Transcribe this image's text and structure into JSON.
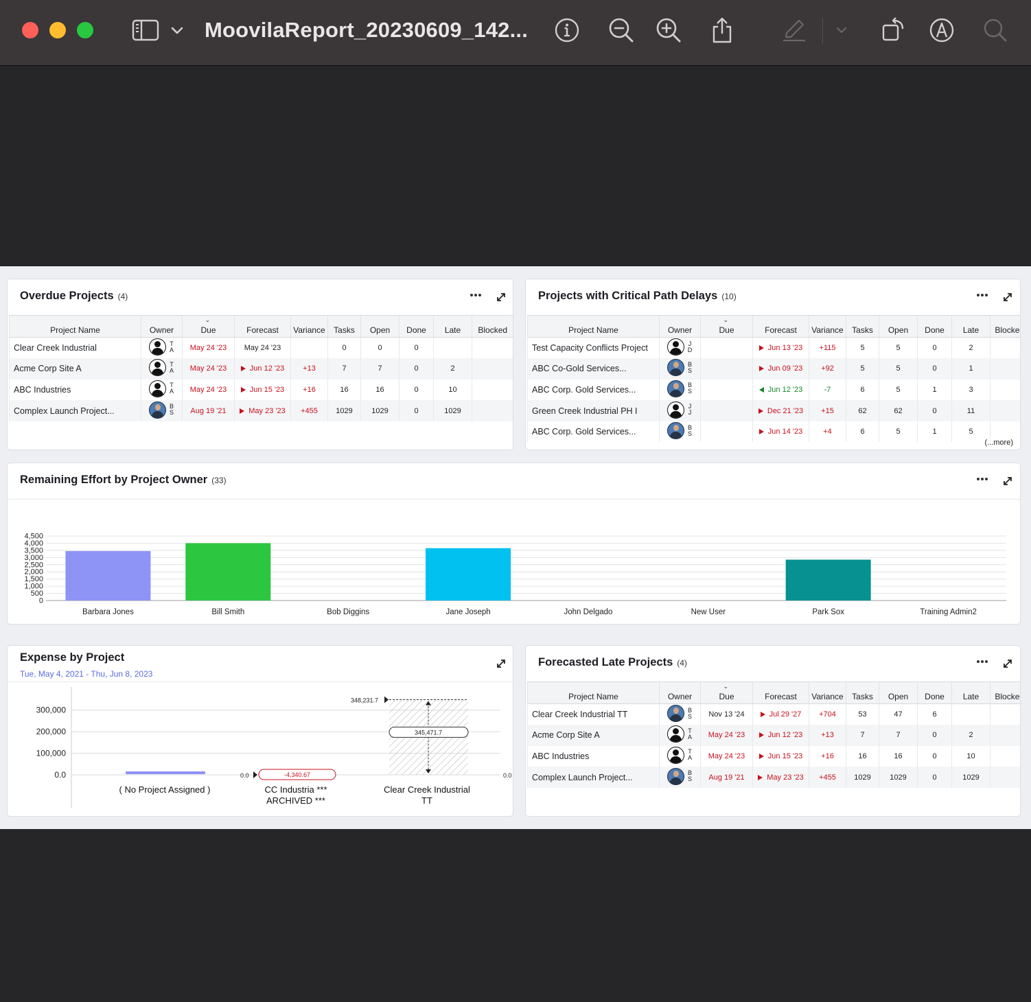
{
  "window": {
    "title": "MoovilaReport_20230609_142..."
  },
  "overdue": {
    "title": "Overdue Projects",
    "count": "(4)",
    "columns": [
      "Project Name",
      "Owner",
      "Due",
      "Forecast",
      "Variance",
      "Tasks",
      "Open",
      "Done",
      "Late",
      "Blocked"
    ],
    "rows": [
      {
        "name": "Clear Creek Industrial",
        "initials": [
          "T",
          "A"
        ],
        "photo": false,
        "due": "May 24 '23",
        "due_red": true,
        "forecast": "May 24 '23",
        "forecast_flag": "none",
        "variance": "",
        "tasks": "0",
        "open": "0",
        "done": "0",
        "late": "",
        "blocked": ""
      },
      {
        "name": "Acme Corp Site A",
        "initials": [
          "T",
          "A"
        ],
        "photo": false,
        "due": "May 24 '23",
        "due_red": true,
        "forecast": "Jun 12 '23",
        "forecast_flag": "late",
        "variance": "+13",
        "tasks": "7",
        "open": "7",
        "done": "0",
        "late": "2",
        "blocked": ""
      },
      {
        "name": "ABC Industries",
        "initials": [
          "T",
          "A"
        ],
        "photo": false,
        "due": "May 24 '23",
        "due_red": true,
        "forecast": "Jun 15 '23",
        "forecast_flag": "late",
        "variance": "+16",
        "tasks": "16",
        "open": "16",
        "done": "0",
        "late": "10",
        "blocked": ""
      },
      {
        "name": "Complex Launch Project...",
        "initials": [
          "B",
          "S"
        ],
        "photo": true,
        "due": "Aug 19 '21",
        "due_red": true,
        "forecast": "May 23 '23",
        "forecast_flag": "late",
        "variance": "+455",
        "tasks": "1029",
        "open": "1029",
        "done": "0",
        "late": "1029",
        "blocked": ""
      }
    ]
  },
  "critical": {
    "title": "Projects with Critical Path Delays",
    "count": "(10)",
    "more": "(...more)",
    "columns": [
      "Project Name",
      "Owner",
      "Due",
      "Forecast",
      "Variance",
      "Tasks",
      "Open",
      "Done",
      "Late",
      "Blocked"
    ],
    "rows": [
      {
        "name": "Test Capacity Conflicts Project",
        "initials": [
          "J",
          "D"
        ],
        "photo": false,
        "due": "",
        "due_red": false,
        "forecast": "Jun 13 '23",
        "forecast_flag": "late",
        "variance": "+115",
        "tasks": "5",
        "open": "5",
        "done": "0",
        "late": "2",
        "blocked": ""
      },
      {
        "name": "ABC Co-Gold Services...",
        "initials": [
          "B",
          "S"
        ],
        "photo": true,
        "due": "",
        "due_red": false,
        "forecast": "Jun 09 '23",
        "forecast_flag": "late",
        "variance": "+92",
        "tasks": "5",
        "open": "5",
        "done": "0",
        "late": "1",
        "blocked": ""
      },
      {
        "name": "ABC Corp. Gold Services...",
        "initials": [
          "B",
          "S"
        ],
        "photo": true,
        "due": "",
        "due_red": false,
        "forecast": "Jun 12 '23",
        "forecast_flag": "early",
        "variance": "-7",
        "tasks": "6",
        "open": "5",
        "done": "1",
        "late": "3",
        "blocked": ""
      },
      {
        "name": "Green Creek Industrial PH I",
        "initials": [
          "J",
          "J"
        ],
        "photo": false,
        "due": "",
        "due_red": false,
        "forecast": "Dec 21 '23",
        "forecast_flag": "late",
        "variance": "+15",
        "tasks": "62",
        "open": "62",
        "done": "0",
        "late": "11",
        "blocked": ""
      },
      {
        "name": "ABC Corp. Gold Services...",
        "initials": [
          "B",
          "S"
        ],
        "photo": true,
        "due": "",
        "due_red": false,
        "forecast": "Jun 14 '23",
        "forecast_flag": "late",
        "variance": "+4",
        "tasks": "6",
        "open": "5",
        "done": "1",
        "late": "5",
        "blocked": ""
      }
    ]
  },
  "effort": {
    "title": "Remaining Effort by Project Owner",
    "count": "(33)"
  },
  "expense": {
    "title": "Expense by Project",
    "subtitle": "Tue, May 4, 2021  -  Thu, Jun 8, 2023"
  },
  "forecasted": {
    "title": "Forecasted Late Projects",
    "count": "(4)",
    "columns": [
      "Project Name",
      "Owner",
      "Due",
      "Forecast",
      "Variance",
      "Tasks",
      "Open",
      "Done",
      "Late",
      "Blocked"
    ],
    "rows": [
      {
        "name": "Clear Creek Industrial TT",
        "initials": [
          "B",
          "S"
        ],
        "photo": true,
        "due": "Nov 13 '24",
        "due_red": false,
        "forecast": "Jul 29 '27",
        "forecast_flag": "late",
        "variance": "+704",
        "tasks": "53",
        "open": "47",
        "done": "6",
        "late": "",
        "blocked": ""
      },
      {
        "name": "Acme Corp Site A",
        "initials": [
          "T",
          "A"
        ],
        "photo": false,
        "due": "May 24 '23",
        "due_red": true,
        "forecast": "Jun 12 '23",
        "forecast_flag": "late",
        "variance": "+13",
        "tasks": "7",
        "open": "7",
        "done": "0",
        "late": "2",
        "blocked": ""
      },
      {
        "name": "ABC Industries",
        "initials": [
          "T",
          "A"
        ],
        "photo": false,
        "due": "May 24 '23",
        "due_red": true,
        "forecast": "Jun 15 '23",
        "forecast_flag": "late",
        "variance": "+16",
        "tasks": "16",
        "open": "16",
        "done": "0",
        "late": "10",
        "blocked": ""
      },
      {
        "name": "Complex Launch Project...",
        "initials": [
          "B",
          "S"
        ],
        "photo": true,
        "due": "Aug 19 '21",
        "due_red": true,
        "forecast": "May 23 '23",
        "forecast_flag": "late",
        "variance": "+455",
        "tasks": "1029",
        "open": "1029",
        "done": "0",
        "late": "1029",
        "blocked": ""
      }
    ]
  },
  "colors": {
    "late_red": "#c8101b",
    "early_green": "#12882a",
    "accent_blue": "#5b6be0"
  },
  "chart_data": [
    {
      "type": "bar",
      "title": "Remaining Effort by Project Owner",
      "categories": [
        "Barbara Jones",
        "Bill Smith",
        "Bob Diggins",
        "Jane Joseph",
        "John Delgado",
        "New User",
        "Park Sox",
        "Training Admin2"
      ],
      "values": [
        3450,
        4000,
        0,
        3650,
        0,
        0,
        2850,
        0
      ],
      "colors": [
        "#8e93f6",
        "#2cc641",
        "#cccccc",
        "#00c1ef",
        "#cccccc",
        "#cccccc",
        "#079190",
        "#cccccc"
      ],
      "yticks": [
        "0",
        "500",
        "1,000",
        "1,500",
        "2,000",
        "2,500",
        "3,000",
        "3,500",
        "4,000",
        "4,500"
      ],
      "ylim": [
        0,
        4500
      ],
      "grid": true
    },
    {
      "type": "waterfall",
      "title": "Expense by Project",
      "categories": [
        "( No Project Assigned )",
        "CC Industria ***\nARCHIVED ***",
        "Clear Creek Industrial\nTT"
      ],
      "category_lines": [
        [
          "( No Project Assigned )"
        ],
        [
          "CC Industria ***",
          "ARCHIVED ***"
        ],
        [
          "Clear Creek Industrial",
          "TT"
        ]
      ],
      "values": [
        0,
        -4340.67,
        348231.7
      ],
      "labels": {
        "start": "0.0",
        "cc_start": "0.0",
        "cc_delta": "-4,340.67",
        "cc_top": "348,231.7",
        "cc_mid": "345,471.7",
        "end": "0.0"
      },
      "yticks": [
        "0.0",
        "100,000",
        "200,000",
        "300,000"
      ],
      "ylim": [
        0,
        350000
      ],
      "grid": true
    }
  ]
}
